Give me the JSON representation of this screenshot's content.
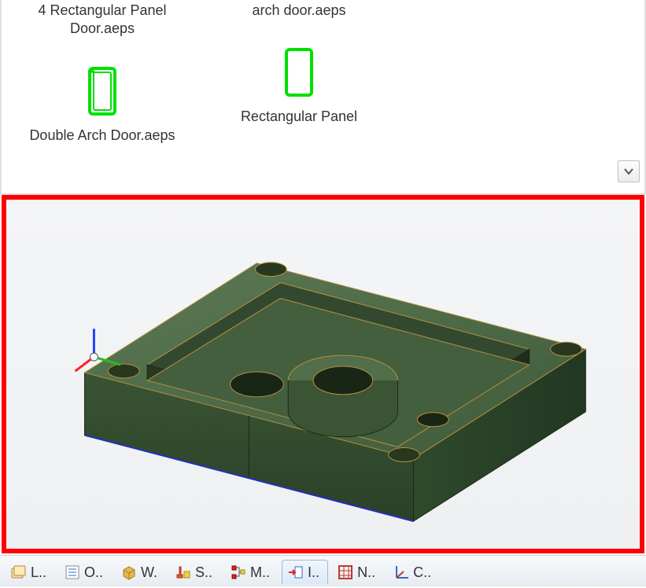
{
  "browser": {
    "items": [
      {
        "label_top": "4 Rectangular Panel Door.aeps",
        "label_bottom": ""
      },
      {
        "label_top": "arch door.aeps",
        "label_bottom": ""
      },
      {
        "label_top": "",
        "label_bottom": "Double Arch Door.aeps"
      },
      {
        "label_top": "",
        "label_bottom": "Rectangular Panel"
      }
    ],
    "scroll_hint": "▼"
  },
  "tabs": [
    {
      "label": "L..",
      "icon": "layers-icon"
    },
    {
      "label": "O..",
      "icon": "outline-icon"
    },
    {
      "label": "W.",
      "icon": "box-icon"
    },
    {
      "label": "S..",
      "icon": "settings-icon"
    },
    {
      "label": "M..",
      "icon": "tree-icon"
    },
    {
      "label": "I..",
      "icon": "import-icon",
      "active": true
    },
    {
      "label": "N..",
      "icon": "net-icon"
    },
    {
      "label": "C..",
      "icon": "coord-icon"
    }
  ]
}
